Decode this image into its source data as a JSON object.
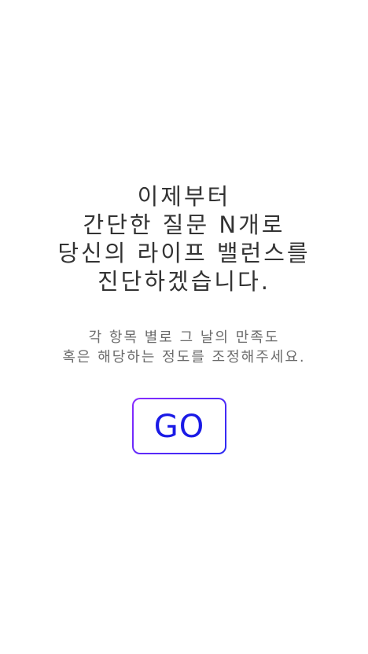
{
  "intro": {
    "title_lines": [
      "이제부터",
      "간단한 질문 N개로",
      "당신의 라이프 밸런스를",
      "진단하겠습니다."
    ],
    "subtitle_lines": [
      "각 항목 별로 그 날의 만족도",
      "혹은 해당하는 정도를 조정해주세요."
    ],
    "go_button_label": "GO"
  },
  "colors": {
    "title_text": "#333333",
    "subtitle_text": "#6b6b6b",
    "button_border_start": "#8a2bff",
    "button_border_end": "#2a2af2",
    "button_label": "#1a1ae6",
    "background": "#ffffff"
  }
}
